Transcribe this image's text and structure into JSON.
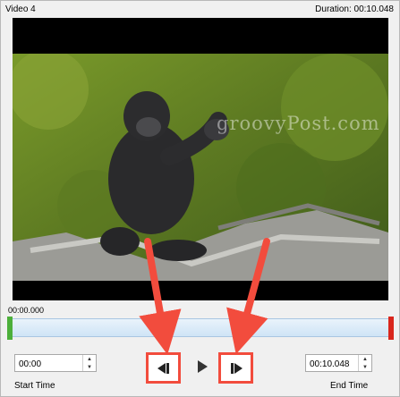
{
  "window": {
    "title": "Video 4",
    "duration": "Duration: 00:10.048"
  },
  "video": {
    "watermark": "groovyPost.com"
  },
  "timeline": {
    "current_time": "00:00.000"
  },
  "start": {
    "value": "00:00",
    "label": "Start Time"
  },
  "end": {
    "value": "00:10.048",
    "label": "End Time"
  },
  "colors": {
    "accent": "#f24c3d",
    "trim_start": "#4caf3a",
    "trim_end": "#d9261c"
  },
  "icons": {
    "prev": "previous-frame-icon",
    "play": "play-icon",
    "next": "next-frame-icon"
  }
}
